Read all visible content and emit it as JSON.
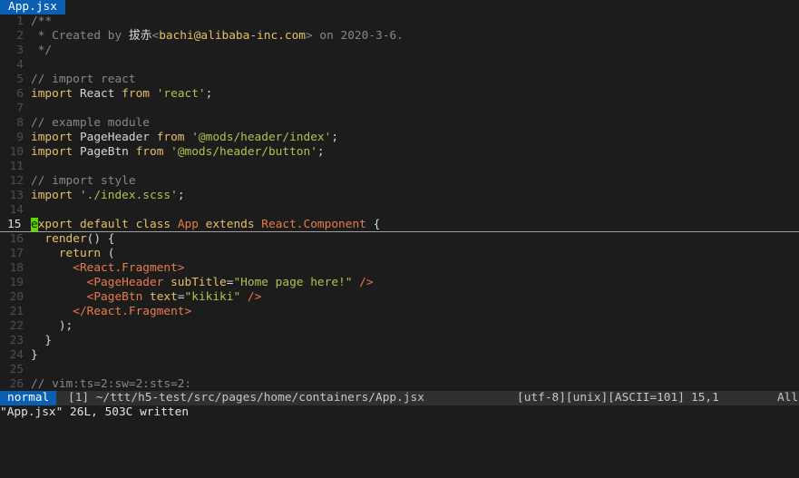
{
  "tab": {
    "label": "App.jsx"
  },
  "lines": [
    {
      "n": "1",
      "segs": [
        {
          "c": "cm",
          "t": "/**"
        }
      ]
    },
    {
      "n": "2",
      "segs": [
        {
          "c": "cm",
          "t": " * Created by "
        },
        {
          "c": "plain",
          "t": "拔赤"
        },
        {
          "c": "cm",
          "t": "<"
        },
        {
          "c": "attr",
          "t": "bachi@alibaba-inc.com"
        },
        {
          "c": "cm",
          "t": "> on 2020-3-6."
        }
      ]
    },
    {
      "n": "3",
      "segs": [
        {
          "c": "cm",
          "t": " */"
        }
      ]
    },
    {
      "n": "4",
      "segs": []
    },
    {
      "n": "5",
      "segs": [
        {
          "c": "cm",
          "t": "// import react"
        }
      ]
    },
    {
      "n": "6",
      "segs": [
        {
          "c": "kw",
          "t": "import "
        },
        {
          "c": "plain",
          "t": "React "
        },
        {
          "c": "kw",
          "t": "from "
        },
        {
          "c": "str",
          "t": "'react'"
        },
        {
          "c": "plain",
          "t": ";"
        }
      ]
    },
    {
      "n": "7",
      "segs": []
    },
    {
      "n": "8",
      "segs": [
        {
          "c": "cm",
          "t": "// example module"
        }
      ]
    },
    {
      "n": "9",
      "segs": [
        {
          "c": "kw",
          "t": "import "
        },
        {
          "c": "plain",
          "t": "PageHeader "
        },
        {
          "c": "kw",
          "t": "from "
        },
        {
          "c": "str",
          "t": "'@mods/header/index'"
        },
        {
          "c": "plain",
          "t": ";"
        }
      ]
    },
    {
      "n": "10",
      "segs": [
        {
          "c": "kw",
          "t": "import "
        },
        {
          "c": "plain",
          "t": "PageBtn "
        },
        {
          "c": "kw",
          "t": "from "
        },
        {
          "c": "str",
          "t": "'@mods/header/button'"
        },
        {
          "c": "plain",
          "t": ";"
        }
      ]
    },
    {
      "n": "11",
      "segs": []
    },
    {
      "n": "12",
      "segs": [
        {
          "c": "cm",
          "t": "// import style"
        }
      ]
    },
    {
      "n": "13",
      "segs": [
        {
          "c": "kw",
          "t": "import "
        },
        {
          "c": "str",
          "t": "'./index.scss'"
        },
        {
          "c": "plain",
          "t": ";"
        }
      ]
    },
    {
      "n": "14",
      "segs": []
    },
    {
      "n": "15",
      "current": true,
      "segs": [
        {
          "c": "cursor",
          "t": "e"
        },
        {
          "c": "kw",
          "t": "xport default class "
        },
        {
          "c": "cls",
          "t": "App "
        },
        {
          "c": "kw",
          "t": "extends "
        },
        {
          "c": "cls",
          "t": "React.Component "
        },
        {
          "c": "plain",
          "t": "{"
        }
      ]
    },
    {
      "n": "16",
      "segs": [
        {
          "c": "plain",
          "t": "  "
        },
        {
          "c": "attr",
          "t": "render"
        },
        {
          "c": "plain",
          "t": "() {"
        }
      ]
    },
    {
      "n": "17",
      "segs": [
        {
          "c": "plain",
          "t": "    "
        },
        {
          "c": "kw",
          "t": "return "
        },
        {
          "c": "plain",
          "t": "("
        }
      ]
    },
    {
      "n": "18",
      "segs": [
        {
          "c": "plain",
          "t": "      "
        },
        {
          "c": "tag",
          "t": "<React.Fragment>"
        }
      ]
    },
    {
      "n": "19",
      "segs": [
        {
          "c": "plain",
          "t": "        "
        },
        {
          "c": "tag",
          "t": "<PageHeader "
        },
        {
          "c": "attr",
          "t": "subTitle"
        },
        {
          "c": "plain",
          "t": "="
        },
        {
          "c": "str",
          "t": "\"Home page here!\""
        },
        {
          "c": "tag",
          "t": " />"
        }
      ]
    },
    {
      "n": "20",
      "segs": [
        {
          "c": "plain",
          "t": "        "
        },
        {
          "c": "tag",
          "t": "<PageBtn "
        },
        {
          "c": "attr",
          "t": "text"
        },
        {
          "c": "plain",
          "t": "="
        },
        {
          "c": "str",
          "t": "\"kikiki\""
        },
        {
          "c": "tag",
          "t": " />"
        }
      ]
    },
    {
      "n": "21",
      "segs": [
        {
          "c": "plain",
          "t": "      "
        },
        {
          "c": "tag",
          "t": "</React.Fragment>"
        }
      ]
    },
    {
      "n": "22",
      "segs": [
        {
          "c": "plain",
          "t": "    );"
        }
      ]
    },
    {
      "n": "23",
      "segs": [
        {
          "c": "plain",
          "t": "  }"
        }
      ]
    },
    {
      "n": "24",
      "segs": [
        {
          "c": "plain",
          "t": "}"
        }
      ]
    },
    {
      "n": "25",
      "segs": []
    },
    {
      "n": "26",
      "segs": [
        {
          "c": "cm",
          "t": "// vim:ts=2:sw=2:sts=2:"
        }
      ]
    }
  ],
  "status": {
    "mode": "normal",
    "filepath": "[1] ~/ttt/h5-test/src/pages/home/containers/App.jsx",
    "fileinfo": "[utf-8][unix][ASCII=101]",
    "position": "15,1",
    "percent": "All"
  },
  "cmdline": "\"App.jsx\" 26L, 503C written"
}
